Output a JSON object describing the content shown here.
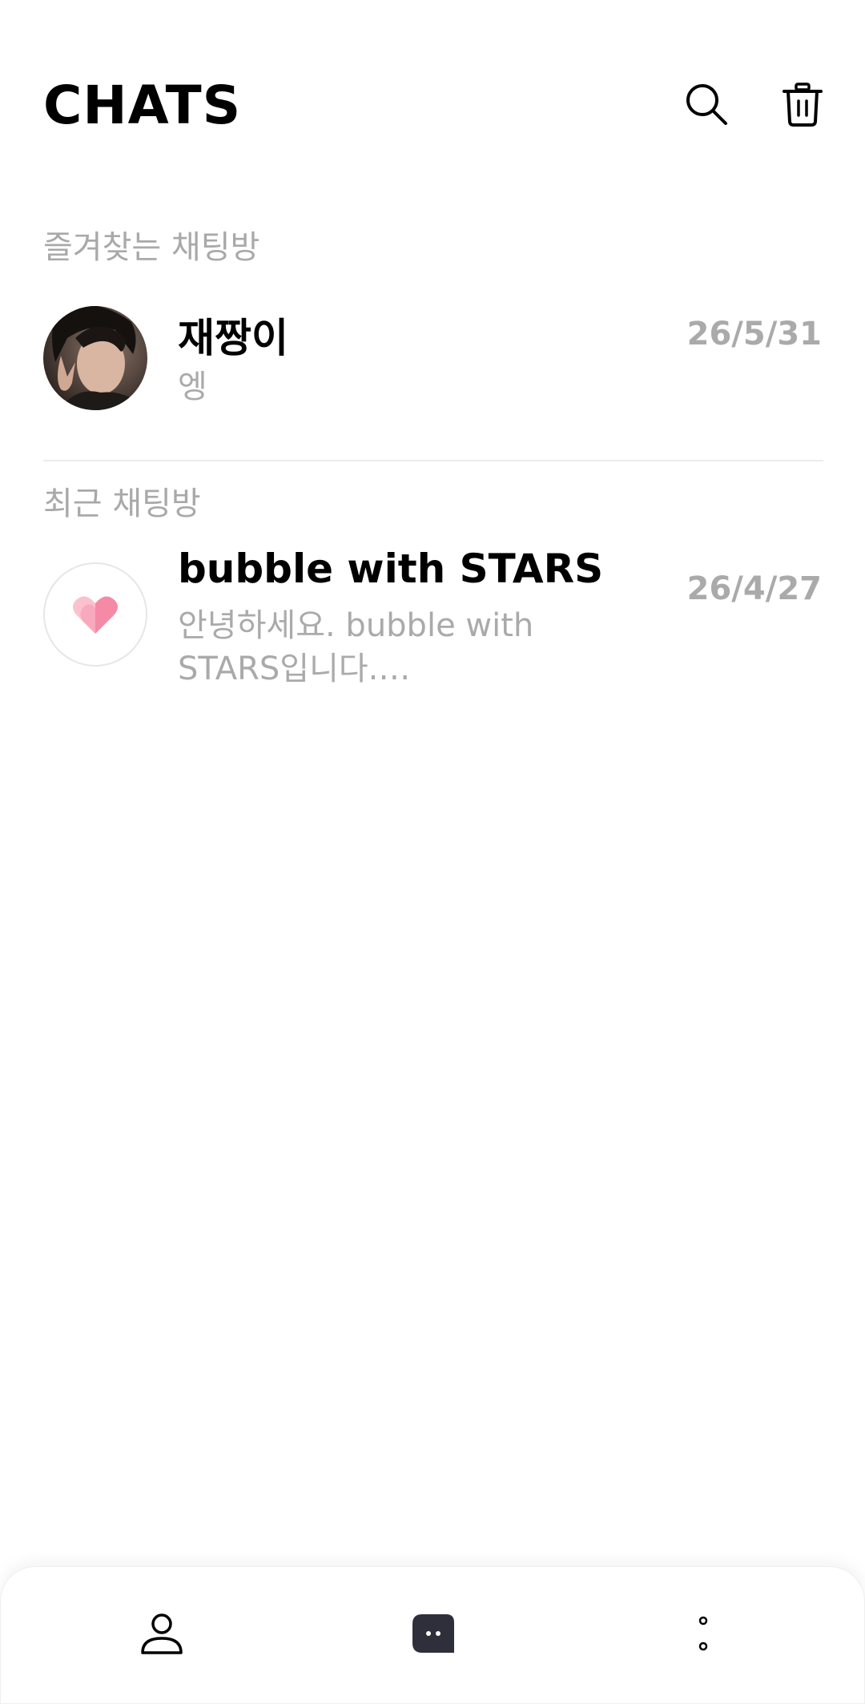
{
  "header": {
    "title": "CHATS",
    "search_icon": "search-icon",
    "trash_icon": "trash-icon"
  },
  "favorites": {
    "label": "즐겨찾는 채팅방",
    "chats": [
      {
        "name": "재짱이",
        "preview": "엥",
        "date": "26/5/31",
        "avatar": "photo-avatar"
      }
    ]
  },
  "recent": {
    "label": "최근 채팅방",
    "chats": [
      {
        "name": "bubble with STARS",
        "preview": "안녕하세요. bubble with STARS입니다.…",
        "date": "26/4/27",
        "avatar": "heart-icon"
      }
    ]
  },
  "bottom_nav": {
    "items": [
      "person-icon",
      "chat-bubble-icon",
      "more-dots-icon"
    ]
  },
  "colors": {
    "heart": "#f48aa6",
    "heart_light": "#fbc1cf",
    "nav_active": "#2e2f3a",
    "muted_text": "#aaaaaa"
  }
}
